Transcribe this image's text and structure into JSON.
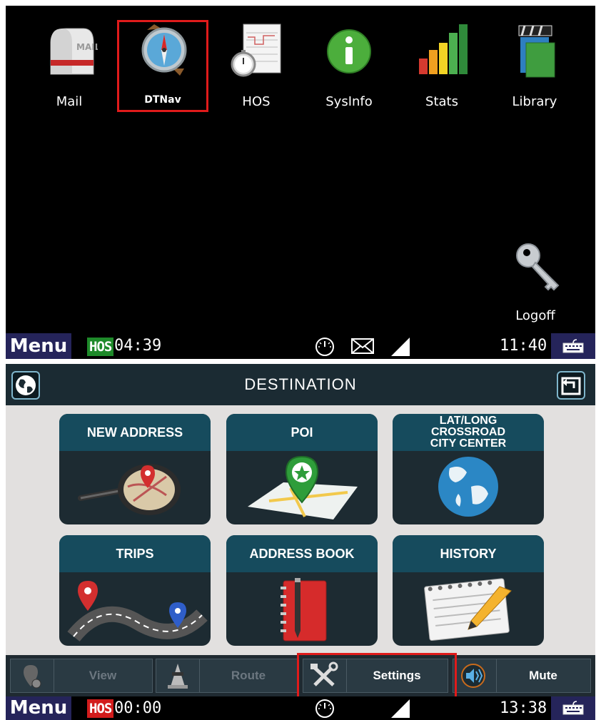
{
  "top_screen": {
    "apps": [
      {
        "label": "Mail",
        "icon": "mailbox-icon"
      },
      {
        "label": "DTNav",
        "icon": "compass-icon"
      },
      {
        "label": "HOS",
        "icon": "logbook-stopwatch-icon"
      },
      {
        "label": "SysInfo",
        "icon": "info-icon"
      },
      {
        "label": "Stats",
        "icon": "bar-chart-icon"
      },
      {
        "label": "Library",
        "icon": "clapperboard-books-icon"
      }
    ],
    "logoff": {
      "label": "Logoff",
      "icon": "key-icon"
    },
    "statusbar": {
      "menu": "Menu",
      "hos": "HOS",
      "hos_time": "04:39",
      "clock": "11:40"
    }
  },
  "bottom_screen": {
    "title": "DESTINATION",
    "tiles": [
      {
        "label": "NEW ADDRESS",
        "icon": "magnifier-map-icon"
      },
      {
        "label": "POI",
        "icon": "poi-pin-map-icon"
      },
      {
        "label": "LAT/LONG\nCROSSROAD\nCITY CENTER",
        "icon": "globe-icon"
      },
      {
        "label": "TRIPS",
        "icon": "road-pins-icon"
      },
      {
        "label": "ADDRESS BOOK",
        "icon": "address-book-icon"
      },
      {
        "label": "HISTORY",
        "icon": "notepad-pencil-icon"
      }
    ],
    "toolbar": {
      "view": "View",
      "route": "Route",
      "settings": "Settings",
      "mute": "Mute"
    },
    "statusbar": {
      "menu": "Menu",
      "hos": "HOS",
      "hos_time": "00:00",
      "clock": "13:38"
    }
  },
  "colors": {
    "highlight": "#e01b1b",
    "hos_green": "#1e8a2a",
    "hos_red": "#d21c1c",
    "menu_bg": "#25245a",
    "tile_bar": "#164b5d"
  }
}
